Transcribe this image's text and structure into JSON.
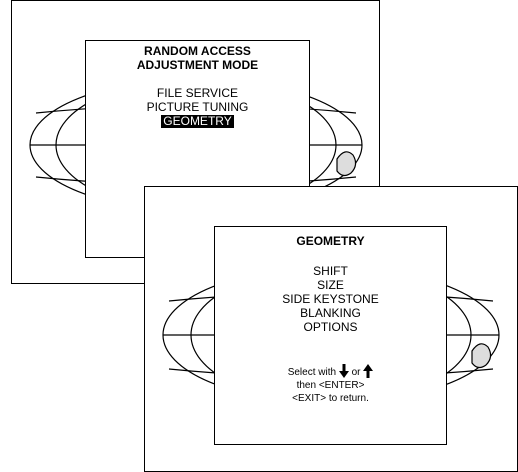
{
  "back_panel": {
    "title_line1": "RANDOM ACCESS",
    "title_line2": "ADJUSTMENT MODE",
    "items": [
      {
        "label": "FILE SERVICE",
        "selected": false
      },
      {
        "label": "PICTURE TUNING",
        "selected": false
      },
      {
        "label": "GEOMETRY",
        "selected": true
      }
    ]
  },
  "front_panel": {
    "title": "GEOMETRY",
    "items": [
      {
        "label": "SHIFT"
      },
      {
        "label": "SIZE"
      },
      {
        "label": "SIDE KEYSTONE"
      },
      {
        "label": "BLANKING"
      },
      {
        "label": "OPTIONS"
      }
    ],
    "hint": {
      "select_with": "Select with",
      "or": "or",
      "line2": "then <ENTER>",
      "line3": "<EXIT> to return.",
      "down_icon": "arrow-down-icon",
      "up_icon": "arrow-up-icon"
    }
  },
  "colors": {
    "background": "#ffffff",
    "foreground": "#000000",
    "highlight_bg": "#000000",
    "highlight_fg": "#ffffff"
  }
}
